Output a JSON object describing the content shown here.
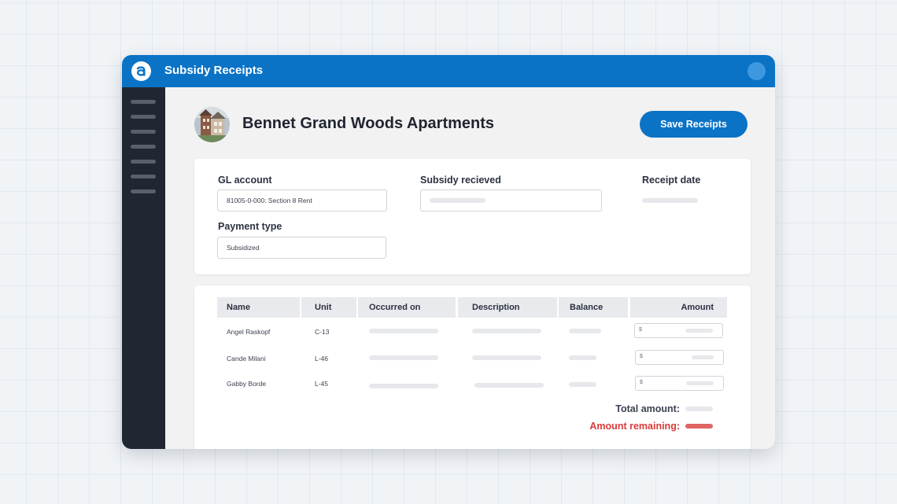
{
  "app": {
    "title": "Subsidy Receipts",
    "logo_letter": "a",
    "accent_color": "#0b73c6"
  },
  "sidebar": {
    "items": [
      "menu-line",
      "menu-line",
      "menu-line",
      "menu-line",
      "menu-line",
      "menu-line",
      "menu-line"
    ]
  },
  "property": {
    "name": "Bennet Grand Woods Apartments",
    "photo_icon": "building-photo"
  },
  "actions": {
    "save_label": "Save Receipts"
  },
  "form": {
    "gl_account_label": "GL account",
    "gl_account_value": "81005-0-000: Section 8 Rent",
    "subsidy_label": "Subsidy recieved",
    "subsidy_value": "",
    "receipt_date_label": "Receipt date",
    "payment_type_label": "Payment type",
    "payment_type_value": "Subsidized"
  },
  "table": {
    "columns": [
      "Name",
      "Unit",
      "Occurred on",
      "Description",
      "Balance",
      "Amount"
    ],
    "rows": [
      {
        "name": "Angel Raskopf",
        "unit": "C-13",
        "currency": "$"
      },
      {
        "name": "Cande Milani",
        "unit": "L-46",
        "currency": "$"
      },
      {
        "name": "Gabby Borde",
        "unit": "L-45",
        "currency": "$"
      }
    ]
  },
  "totals": {
    "total_label": "Total amount:",
    "remaining_label": "Amount remaining:",
    "remaining_color": "#d93a3a"
  }
}
